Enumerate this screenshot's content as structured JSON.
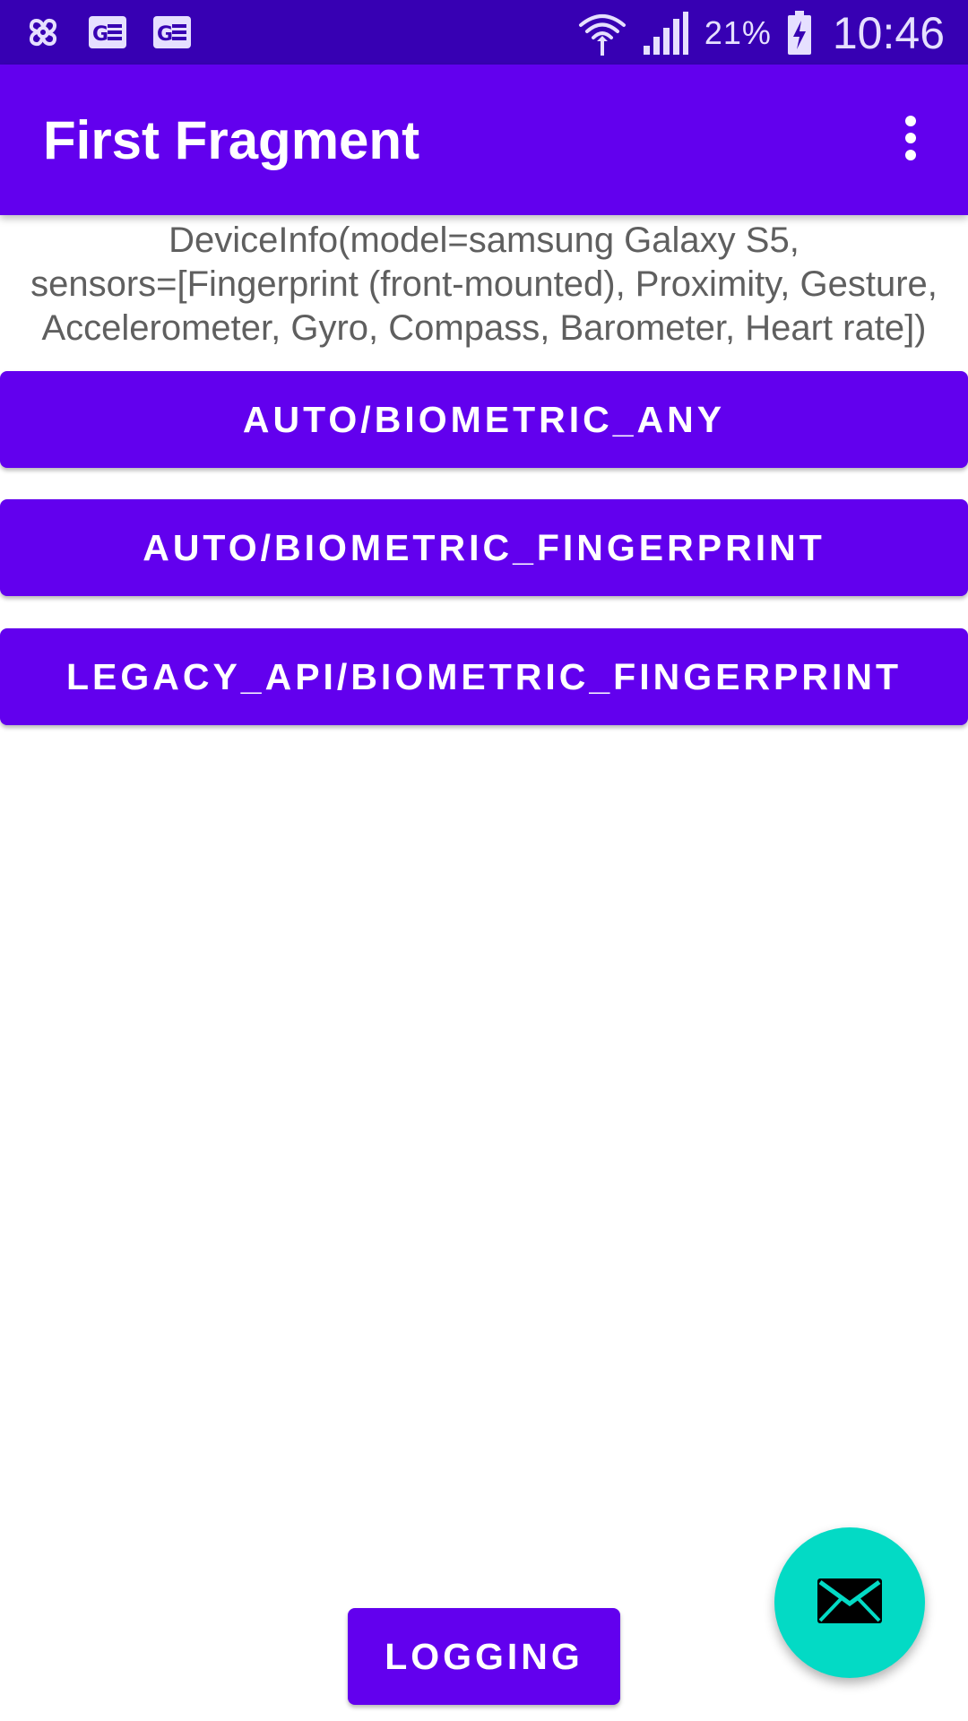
{
  "status_bar": {
    "left_icons": [
      "pinwheel-icon",
      "ge-app-icon",
      "ge-app-icon"
    ],
    "right_icons": [
      "wifi-icon",
      "signal-icon",
      "battery-charging-icon"
    ],
    "battery_percent": "21%",
    "time": "10:46"
  },
  "app_bar": {
    "title": "First Fragment",
    "overflow_icon": "more-vert-icon"
  },
  "device_info": {
    "line1": "DeviceInfo(model=samsung Galaxy S5,",
    "line2": "sensors=[Fingerprint (front-mounted), Proximity, Gesture,",
    "line3": "Accelerometer, Gyro, Compass, Barometer, Heart rate])"
  },
  "buttons": [
    {
      "label": "AUTO/BIOMETRIC_ANY"
    },
    {
      "label": "AUTO/BIOMETRIC_FINGERPRINT"
    },
    {
      "label": "LEGACY_API/BIOMETRIC_FINGERPRINT"
    }
  ],
  "logging_button": {
    "label": "LOGGING"
  },
  "fab": {
    "icon": "email-icon"
  },
  "colors": {
    "primary": "#6200EE",
    "primary_dark": "#3700B3",
    "secondary": "#03DAC5",
    "text_secondary": "#5f5f5f"
  }
}
